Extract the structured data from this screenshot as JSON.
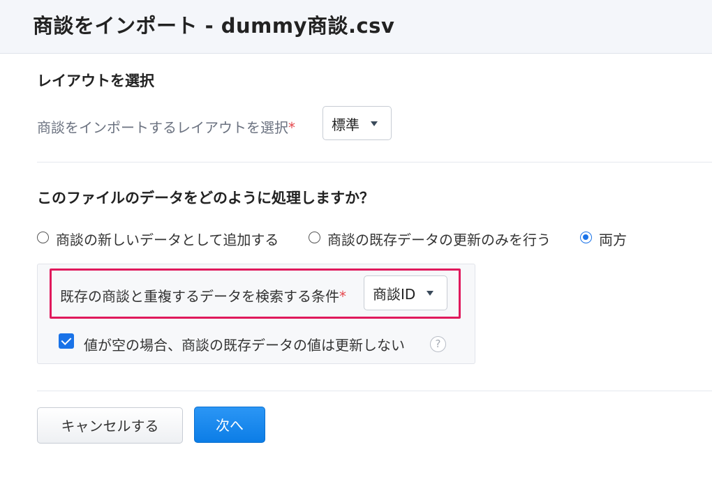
{
  "header": {
    "title": "商談をインポート - dummy商談.csv"
  },
  "layout_section": {
    "title": "レイアウトを選択",
    "field_label": "商談をインポートするレイアウトを選択",
    "required_mark": "*",
    "selected_value": "標準",
    "caret_icon": "caret-down-icon"
  },
  "process_section": {
    "title": "このファイルのデータをどのように処理しますか？",
    "options": [
      {
        "label": "商談の新しいデータとして追加する",
        "checked": false
      },
      {
        "label": "商談の既存データの更新のみを行う",
        "checked": false
      },
      {
        "label": "両方",
        "checked": true
      }
    ]
  },
  "duplicate_panel": {
    "condition_label": "既存の商談と重複するデータを検索する条件",
    "required_mark": "*",
    "selected_value": "商談ID",
    "caret_icon": "caret-down-icon",
    "highlight_color": "#e0195c",
    "checkbox_label": "値が空の場合、商談の既存データの値は更新しない",
    "checkbox_checked": true,
    "help_icon": "?"
  },
  "footer": {
    "cancel_label": "キャンセルする",
    "next_label": "次へ"
  },
  "colors": {
    "accent": "#1a73e8",
    "required": "#e5484d",
    "primary_button": "#0c7de6"
  }
}
